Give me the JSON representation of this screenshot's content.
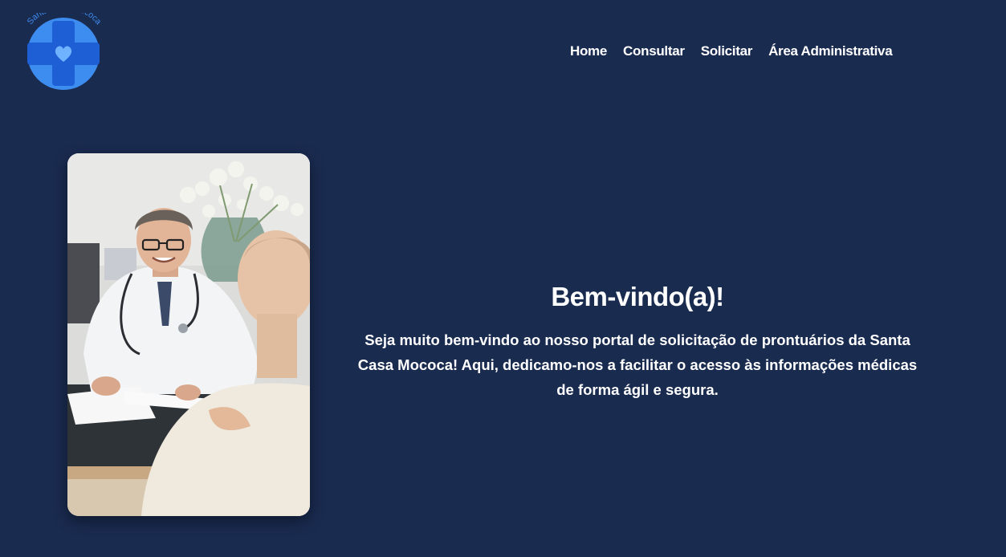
{
  "colors": {
    "background": "#1a2b50",
    "logo_blue": "#3d8df0",
    "logo_dark_blue": "#1f5fd6",
    "text": "#ffffff"
  },
  "logo": {
    "text": "Santa Casa Mococa",
    "icon": "medical-cross-heart-icon"
  },
  "nav": {
    "items": [
      {
        "label": "Home"
      },
      {
        "label": "Consultar"
      },
      {
        "label": "Solicitar"
      },
      {
        "label": "Área Administrativa"
      }
    ]
  },
  "hero": {
    "image": "doctor-patient-consultation-photo"
  },
  "welcome": {
    "title": "Bem-vindo(a)!",
    "text": "Seja muito bem-vindo ao nosso portal de solicitação de prontuários da Santa Casa Mococa! Aqui, dedicamo-nos a facilitar o acesso às informações médicas de forma ágil e segura."
  }
}
